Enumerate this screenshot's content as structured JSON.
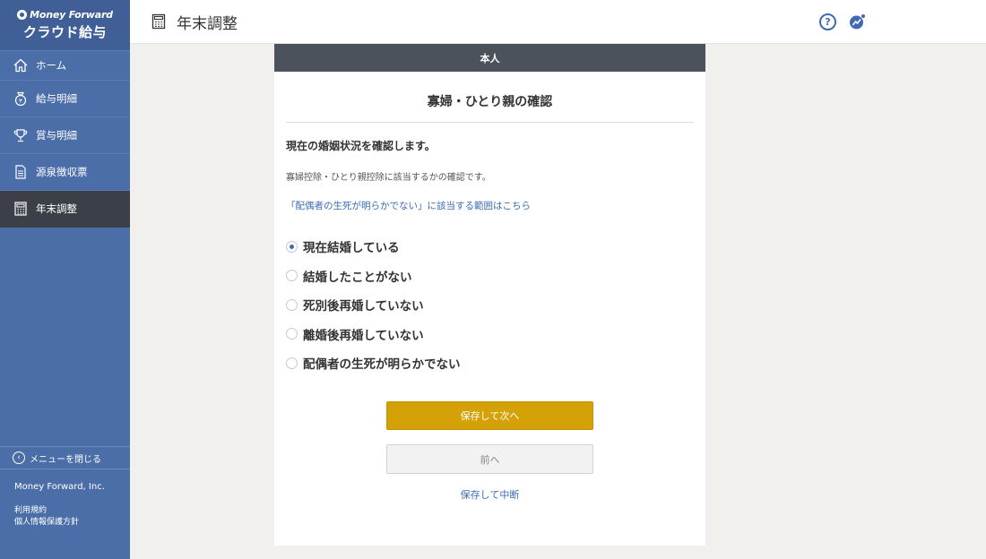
{
  "brand": {
    "line1": "Money Forward",
    "line2": "クラウド給与"
  },
  "sidebar": {
    "items": [
      {
        "label": "ホーム",
        "icon": "home-icon"
      },
      {
        "label": "給与明細",
        "icon": "money-bag-icon"
      },
      {
        "label": "賞与明細",
        "icon": "trophy-icon"
      },
      {
        "label": "源泉徴収票",
        "icon": "document-icon"
      },
      {
        "label": "年末調整",
        "icon": "calculator-icon",
        "active": true
      }
    ],
    "close_menu": "メニューを閉じる",
    "company": "Money Forward, Inc.",
    "terms": "利用規約",
    "privacy": "個人情報保護方針"
  },
  "header": {
    "title": "年末調整",
    "help_icon": "help-icon",
    "help_glyph": "?",
    "notify_icon": "notification-icon"
  },
  "card": {
    "section": "本人",
    "title": "寡婦・ひとり親の確認",
    "question": "現在の婚姻状況を確認します。",
    "description": "寡婦控除・ひとり親控除に該当するかの確認です。",
    "link": "「配偶者の生死が明らかでない」に該当する範囲はこちら",
    "options": [
      {
        "label": "現在結婚している",
        "checked": true
      },
      {
        "label": "結婚したことがない",
        "checked": false
      },
      {
        "label": "死別後再婚していない",
        "checked": false
      },
      {
        "label": "離婚後再婚していない",
        "checked": false
      },
      {
        "label": "配偶者の生死が明らかでない",
        "checked": false
      }
    ],
    "primary_button": "保存して次へ",
    "back_button": "前へ",
    "suspend_link": "保存して中断"
  },
  "colors": {
    "sidebar": "#4b6ea8",
    "active": "#3c3f47",
    "accent": "#d4a106",
    "link": "#3b6cb4"
  }
}
